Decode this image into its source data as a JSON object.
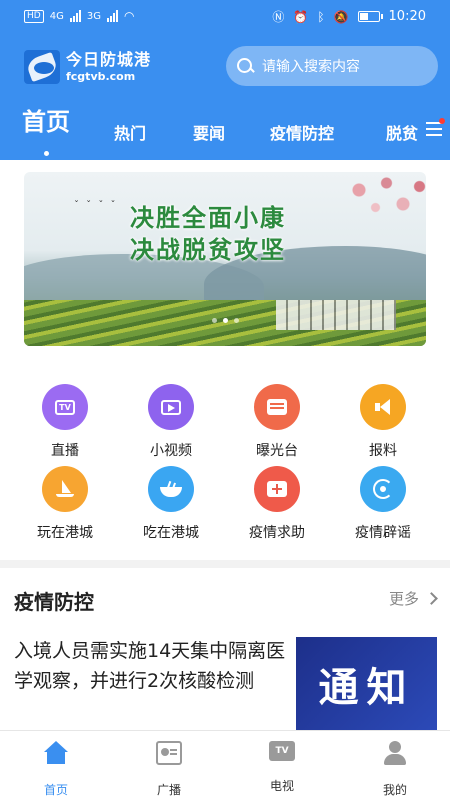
{
  "status_bar": {
    "hd": "HD",
    "net1": "4G",
    "net2": "3G",
    "time": "10:20"
  },
  "header": {
    "logo_cn": "今日防城港",
    "logo_en": "fcgtvb.com",
    "search_placeholder": "请输入搜索内容"
  },
  "tabs": [
    {
      "label": "首页",
      "active": true
    },
    {
      "label": "热门"
    },
    {
      "label": "要闻"
    },
    {
      "label": "疫情防控"
    },
    {
      "label": "脱贫"
    }
  ],
  "banner": {
    "line1": "决胜全面小康",
    "line2": "决战脱贫攻坚",
    "dots_total": 3,
    "dot_active": 2
  },
  "services": [
    {
      "label": "直播",
      "icon": "tv-icon",
      "color": "#9b6bf2"
    },
    {
      "label": "小视频",
      "icon": "video-play-icon",
      "color": "#8e63ee"
    },
    {
      "label": "曝光台",
      "icon": "news-card-icon",
      "color": "#f06a4a"
    },
    {
      "label": "报料",
      "icon": "megaphone-icon",
      "color": "#f6a623"
    },
    {
      "label": "玩在港城",
      "icon": "sailboat-icon",
      "color": "#f7a531"
    },
    {
      "label": "吃在港城",
      "icon": "food-bowl-icon",
      "color": "#3aa6f2"
    },
    {
      "label": "疫情求助",
      "icon": "medical-kit-icon",
      "color": "#ef5a4a"
    },
    {
      "label": "疫情辟谣",
      "icon": "refresh-check-icon",
      "color": "#3aa9f0"
    }
  ],
  "section": {
    "title": "疫情防控",
    "more": "更多"
  },
  "news": [
    {
      "title": "入境人员需实施14天集中隔离医学观察，并进行2次核酸检测",
      "thumb_text": "通知"
    }
  ],
  "bottom_nav": [
    {
      "label": "首页",
      "icon": "home-icon",
      "active": true
    },
    {
      "label": "广播",
      "icon": "radio-icon"
    },
    {
      "label": "电视",
      "icon": "tv-icon"
    },
    {
      "label": "我的",
      "icon": "user-icon"
    }
  ],
  "colors": {
    "brand_blue": "#3a8ff0",
    "banner_text_green": "#2c8a3e"
  }
}
